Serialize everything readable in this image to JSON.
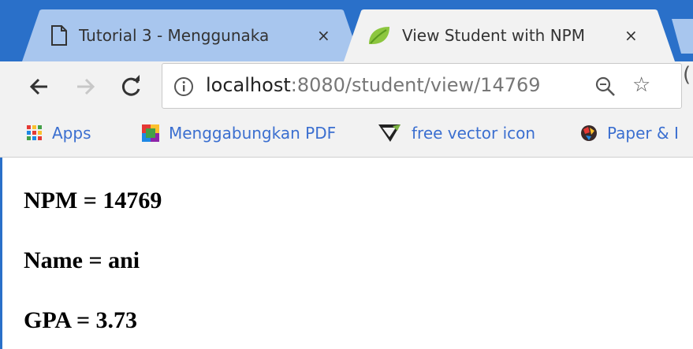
{
  "browser": {
    "tabs": [
      {
        "title": "Tutorial 3 - Menggunaka",
        "close": "×",
        "active": false
      },
      {
        "title": "View Student with NPM",
        "close": "×",
        "active": true
      }
    ],
    "address_bar": {
      "host": "localhost",
      "rest": ":8080/student/view/14769"
    },
    "bookmarks": [
      {
        "label": "Apps",
        "icon": "apps-grid-icon"
      },
      {
        "label": "Menggabungkan PDF",
        "icon": "pdf-merge-icon"
      },
      {
        "label": "free vector icon",
        "icon": "vector-logo-icon"
      },
      {
        "label": "Paper & I",
        "icon": "paper-globe-icon"
      }
    ]
  },
  "page": {
    "npm_line": "NPM = 14769",
    "name_line": "Name = ani",
    "gpa_line": "GPA = 3.73"
  },
  "colors": {
    "tabstrip": "#2a70c9",
    "active_tab": "#f2f2f2",
    "inactive_tab": "#a8c6ee",
    "bookmark_text": "#3b6fd0"
  }
}
